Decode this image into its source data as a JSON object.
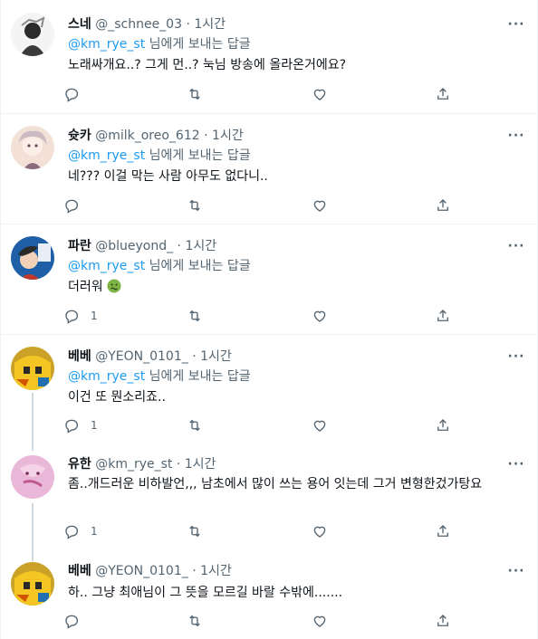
{
  "tweets": [
    {
      "name": "스네",
      "handle": "@_schnee_03",
      "dot": "·",
      "time": "1시간",
      "reply_mention": "@km_rye_st",
      "reply_suffix": " 님에게 보내는 답글",
      "text": "노래싸개요..? 그게 먼..? 눅님 방송에 올라온거에요?",
      "reply_count": "",
      "avatar": "avatar-schnee"
    },
    {
      "name": "슛카",
      "handle": "@milk_oreo_612",
      "dot": "·",
      "time": "1시간",
      "reply_mention": "@km_rye_st",
      "reply_suffix": " 님에게 보내는 답글",
      "text": "네??? 이걸 막는 사람 아무도 없다니..",
      "reply_count": "",
      "avatar": "avatar-milk"
    },
    {
      "name": "파란",
      "handle": "@blueyond_",
      "dot": "·",
      "time": "1시간",
      "reply_mention": "@km_rye_st",
      "reply_suffix": " 님에게 보내는 답글",
      "text": "더러워",
      "emoji": "nauseated-face-emoji",
      "reply_count": "1",
      "avatar": "avatar-blueyond"
    },
    {
      "name": "베베",
      "handle": "@YEON_0101_",
      "dot": "·",
      "time": "1시간",
      "reply_mention": "@km_rye_st",
      "reply_suffix": " 님에게 보내는 답글",
      "text": "이건 또 뭔소리죠..",
      "reply_count": "1",
      "avatar": "avatar-yeon"
    },
    {
      "name": "유한",
      "handle": "@km_rye_st",
      "dot": "·",
      "time": "1시간",
      "text": "좀..개드러운 비하발언,,, 남초에서 많이 쓰는 용어 잇는데 그거 변형한겄가탕요",
      "reply_count": "1",
      "avatar": "avatar-kmrye"
    },
    {
      "name": "베베",
      "handle": "@YEON_0101_",
      "dot": "·",
      "time": "1시간",
      "text": "하.. 그냥 최애님이 그 뜻을 모르길 바랄 수밖에.......",
      "reply_count": "",
      "avatar": "avatar-yeon"
    }
  ],
  "icons": {
    "reply": "reply-icon",
    "retweet": "retweet-icon",
    "like": "like-icon",
    "share": "share-icon",
    "more": "more-icon"
  },
  "colors": {
    "link": "#1d9bf0",
    "secondary": "#536471",
    "text": "#0f1419",
    "divider": "#eff3f4"
  }
}
